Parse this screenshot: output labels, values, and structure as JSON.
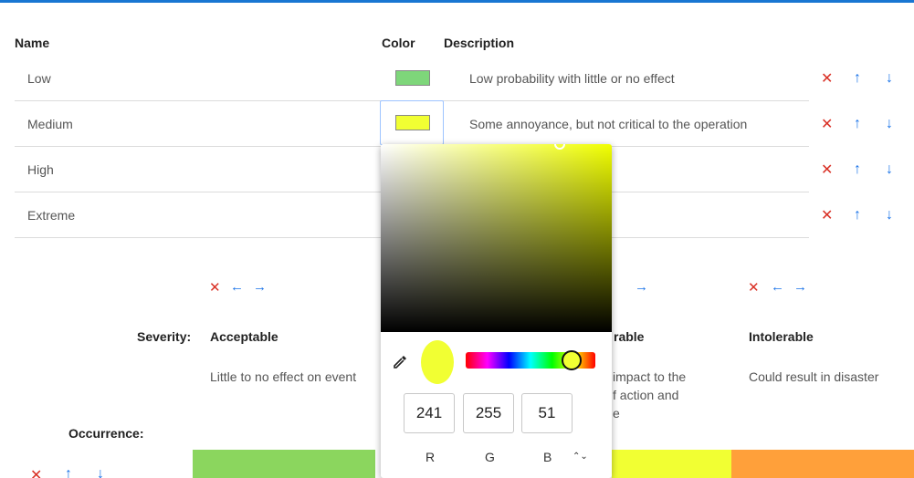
{
  "headers": {
    "name": "Name",
    "color": "Color",
    "description": "Description"
  },
  "rows": [
    {
      "name": "Low",
      "color": "#7ed67a",
      "description": "Low probability with little or no effect"
    },
    {
      "name": "Medium",
      "color": "#f1ff33",
      "description": "Some annoyance, but not critical to the operation"
    },
    {
      "name": "High",
      "color": "",
      "description": ""
    },
    {
      "name": "Extreme",
      "color": "",
      "description": ""
    }
  ],
  "row_actions": {
    "remove": "✕",
    "up": "↑",
    "down": "↓"
  },
  "col_actions": {
    "remove": "✕",
    "left": "←",
    "right": "→"
  },
  "matrix": {
    "severity_label": "Severity:",
    "occurrence_label": "Occurrence:",
    "columns": [
      {
        "title": "Acceptable",
        "text": "Little to no effect on event",
        "band_color": "#8bd65e"
      },
      {
        "title": "rable",
        "text": "impact to the\nf action and\ne",
        "band_color": "#f1ff33"
      },
      {
        "title": "Intolerable",
        "text": "Could result in disaster",
        "band_color": "#ffa03a"
      }
    ]
  },
  "picker": {
    "dropper_icon": "eyedropper-icon",
    "r": "241",
    "g": "255",
    "b": "51",
    "r_label": "R",
    "g_label": "G",
    "b_label": "B",
    "toggle": "⌃⌄",
    "current_color": "#f1ff33"
  }
}
